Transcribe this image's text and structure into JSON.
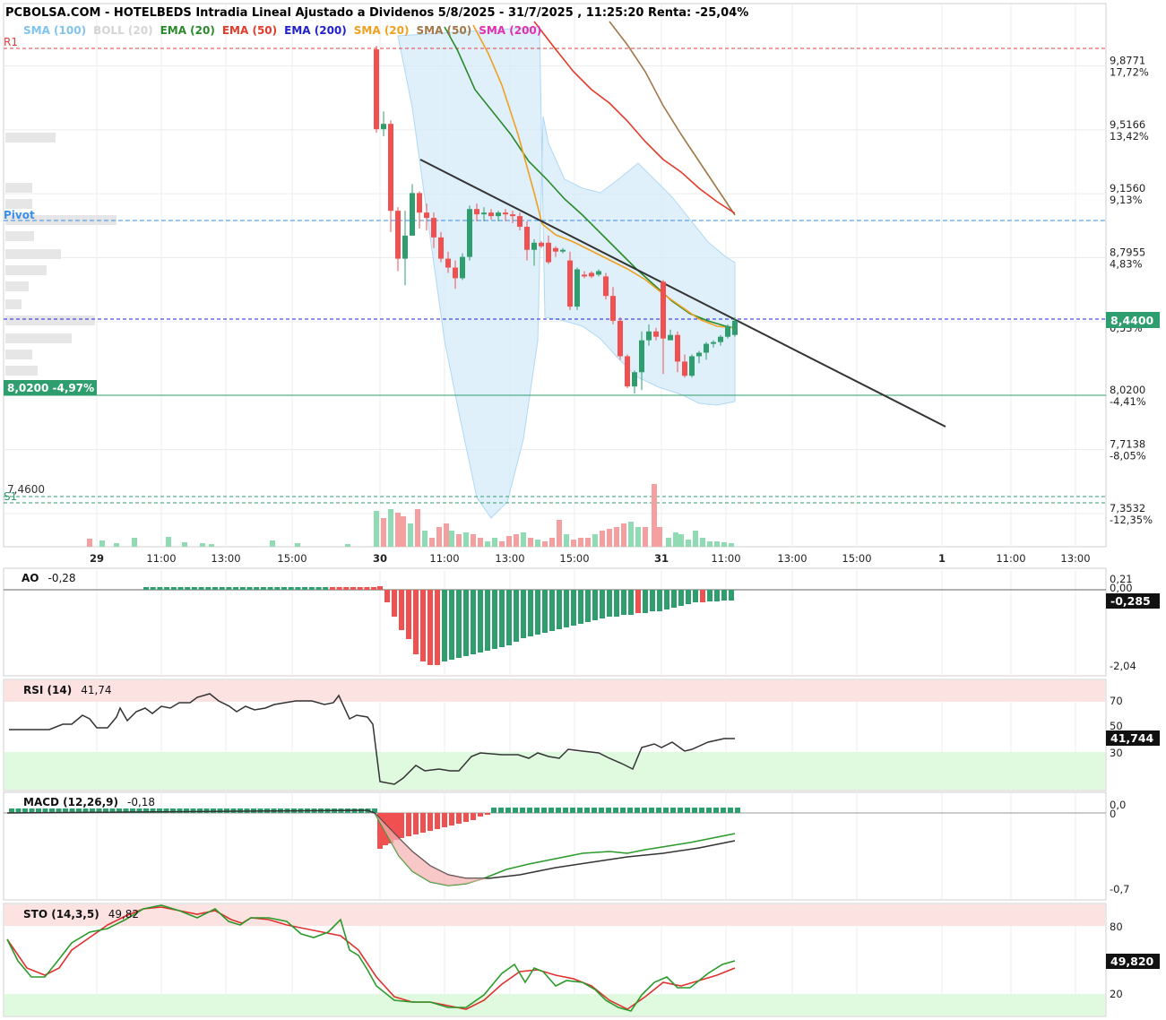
{
  "header": {
    "title": "PCBOLSA.COM - HOTELBEDS Intradia Lineal Ajustado a Dividenos 5/8/2025 - 31/7/2025 , 11:25:20 Renta: -25,04%",
    "legend": [
      {
        "label": "SMA (100)",
        "color": "#7fc3ee"
      },
      {
        "label": "BOLL (20)",
        "color": "#d4d4d4"
      },
      {
        "label": "EMA (20)",
        "color": "#2a8a2a"
      },
      {
        "label": "EMA (50)",
        "color": "#e33a2a"
      },
      {
        "label": "EMA (200)",
        "color": "#2121c8"
      },
      {
        "label": "SMA (20)",
        "color": "#f0a020"
      },
      {
        "label": "SMA (50)",
        "color": "#a0784a"
      },
      {
        "label": "SMA (200)",
        "color": "#e030b0"
      }
    ]
  },
  "price_axis": {
    "ticks": [
      {
        "price": "9,8771",
        "pct": "17,72%",
        "pos": true
      },
      {
        "price": "9,5166",
        "pct": "13,42%",
        "pos": true
      },
      {
        "price": "9,1560",
        "pct": "9,13%",
        "pos": true
      },
      {
        "price": "8,7955",
        "pct": "4,83%",
        "pos": true
      },
      {
        "price": "8,4349",
        "pct": "0,53%",
        "pos": true
      },
      {
        "price": "8,0200",
        "pct": "-4,41%",
        "pos": false
      },
      {
        "price": "7,7138",
        "pct": "-8,05%",
        "pos": false
      },
      {
        "price": "7,3532",
        "pct": "-12,35%",
        "pos": false
      }
    ],
    "current_price": "8,4400",
    "support_label": "8,0200  -4,97%",
    "s1_value": "7,4600"
  },
  "levels": {
    "r1": "R1",
    "pivot": "Pivot",
    "s1": "S1"
  },
  "x_axis": {
    "labels": [
      {
        "t": "29",
        "bold": true
      },
      {
        "t": "11:00"
      },
      {
        "t": "13:00"
      },
      {
        "t": "15:00"
      },
      {
        "t": "30",
        "bold": true
      },
      {
        "t": "11:00"
      },
      {
        "t": "13:00"
      },
      {
        "t": "15:00"
      },
      {
        "t": "31",
        "bold": true
      },
      {
        "t": "11:00"
      },
      {
        "t": "13:00"
      },
      {
        "t": "15:00"
      },
      {
        "t": "1",
        "bold": true
      },
      {
        "t": "11:00"
      },
      {
        "t": "13:00"
      }
    ]
  },
  "panels": {
    "ao": {
      "name": "AO",
      "value": "-0,28",
      "ticks": [
        "0,21",
        "0,00",
        "-2,04"
      ],
      "current": "-0,285"
    },
    "rsi": {
      "name": "RSI (14)",
      "value": "41,74",
      "ticks": [
        "70",
        "50",
        "30"
      ],
      "current": "41,744"
    },
    "macd": {
      "name": "MACD (12,26,9)",
      "value": "-0,18",
      "ticks": [
        "0,0",
        "0",
        "-0,7"
      ]
    },
    "sto": {
      "name": "STO (14,3,5)",
      "value": "49,82",
      "ticks": [
        "80",
        "20"
      ],
      "current": "49,820"
    }
  },
  "colors": {
    "up": "#2e9e6e",
    "down": "#f05050",
    "up_light": "#8fdcb4",
    "down_light": "#f5a0a0"
  },
  "chart_data": {
    "type": "candlestick",
    "candles": [
      [
        9.97,
        9.99,
        9.5,
        9.52
      ],
      [
        9.52,
        9.62,
        9.48,
        9.55
      ],
      [
        9.55,
        9.57,
        8.94,
        9.06
      ],
      [
        9.06,
        9.08,
        8.72,
        8.79
      ],
      [
        8.79,
        9.06,
        8.64,
        8.92
      ],
      [
        8.92,
        9.21,
        8.92,
        9.16
      ],
      [
        9.16,
        9.17,
        8.96,
        9.05
      ],
      [
        9.05,
        9.1,
        8.95,
        9.02
      ],
      [
        9.02,
        9.05,
        8.85,
        8.91
      ],
      [
        8.91,
        8.94,
        8.77,
        8.79
      ],
      [
        8.79,
        8.83,
        8.71,
        8.74
      ],
      [
        8.74,
        8.78,
        8.62,
        8.68
      ],
      [
        8.68,
        8.82,
        8.67,
        8.8
      ],
      [
        8.8,
        9.09,
        8.78,
        9.07
      ],
      [
        9.07,
        9.1,
        9.0,
        9.04
      ],
      [
        9.04,
        9.08,
        9.0,
        9.05
      ],
      [
        9.05,
        9.07,
        9.01,
        9.03
      ],
      [
        9.03,
        9.06,
        9.0,
        9.05
      ],
      [
        9.05,
        9.07,
        9.0,
        9.04
      ],
      [
        9.04,
        9.06,
        8.99,
        9.03
      ],
      [
        9.03,
        9.05,
        8.95,
        8.97
      ],
      [
        8.97,
        9.0,
        8.78,
        8.84
      ],
      [
        8.84,
        8.9,
        8.75,
        8.88
      ],
      [
        8.88,
        8.89,
        8.85,
        8.86
      ],
      [
        8.88,
        8.92,
        8.76,
        8.77
      ],
      [
        8.85,
        8.86,
        8.8,
        8.83
      ],
      [
        8.83,
        8.85,
        8.82,
        8.84
      ],
      [
        8.78,
        8.83,
        8.5,
        8.52
      ],
      [
        8.52,
        8.74,
        8.5,
        8.73
      ],
      [
        8.7,
        8.72,
        8.68,
        8.69
      ],
      [
        8.71,
        8.72,
        8.68,
        8.69
      ],
      [
        8.7,
        8.73,
        8.69,
        8.72
      ],
      [
        8.69,
        8.71,
        8.56,
        8.58
      ],
      [
        8.58,
        8.63,
        8.42,
        8.44
      ],
      [
        8.44,
        8.46,
        8.22,
        8.24
      ],
      [
        8.24,
        8.25,
        8.06,
        8.07
      ],
      [
        8.07,
        8.16,
        8.03,
        8.15
      ],
      [
        8.15,
        8.38,
        8.05,
        8.33
      ],
      [
        8.33,
        8.42,
        8.3,
        8.38
      ],
      [
        8.38,
        8.4,
        8.33,
        8.35
      ],
      [
        8.66,
        8.67,
        8.14,
        8.34
      ],
      [
        8.33,
        8.39,
        8.34,
        8.36
      ],
      [
        8.36,
        8.38,
        8.15,
        8.21
      ],
      [
        8.21,
        8.25,
        8.12,
        8.13
      ],
      [
        8.13,
        8.25,
        8.12,
        8.24
      ],
      [
        8.24,
        8.27,
        8.2,
        8.26
      ],
      [
        8.26,
        8.32,
        8.22,
        8.31
      ],
      [
        8.31,
        8.33,
        8.29,
        8.32
      ],
      [
        8.32,
        8.36,
        8.3,
        8.35
      ],
      [
        8.35,
        8.42,
        8.34,
        8.41
      ],
      [
        8.36,
        8.46,
        8.35,
        8.44
      ]
    ]
  }
}
